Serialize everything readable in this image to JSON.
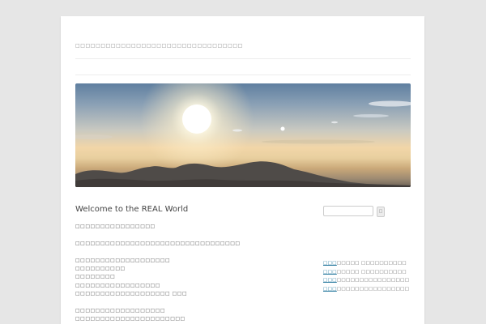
{
  "site": {
    "tagline": "□□□□□□□□□□□□□□□□□□□□□□□□□□□□□□□□□"
  },
  "post": {
    "title": "Welcome to the REAL World",
    "paragraphs": [
      [
        "□□□□□□□□□□□□□□□□"
      ],
      [
        "□□□□□□□□□□□□□□□□□□□□□□□□□□□□□□□□□"
      ],
      [
        "□□□□□□□□□□□□□□□□□□□",
        "□□□□□□□□□□",
        "□□□□□□□□",
        "□□□□□□□□□□□□□□□□□",
        "□□□□□□□□□□□□□□□□□□□ □□□"
      ],
      [
        "□□□□□□□□□□□□□□□□□□",
        "□□□□□□□□□□□□□□□□□□□□□□"
      ]
    ]
  },
  "sidebar": {
    "search_button_label": "□",
    "recent": [
      {
        "link": "□□□",
        "text": "□□□□□ □□□□□□□□□□"
      },
      {
        "link": "□□□",
        "text": "□□□□□ □□□□□□□□□□"
      },
      {
        "link": "□□□",
        "text": "□□□□□□□□□□□□□□□□"
      },
      {
        "link": "□□□",
        "text": "□□□□□□□□□□□□□□□□"
      }
    ]
  },
  "header_image": {
    "subject": "sunrise above a sea of clouds with mountain ridges"
  }
}
